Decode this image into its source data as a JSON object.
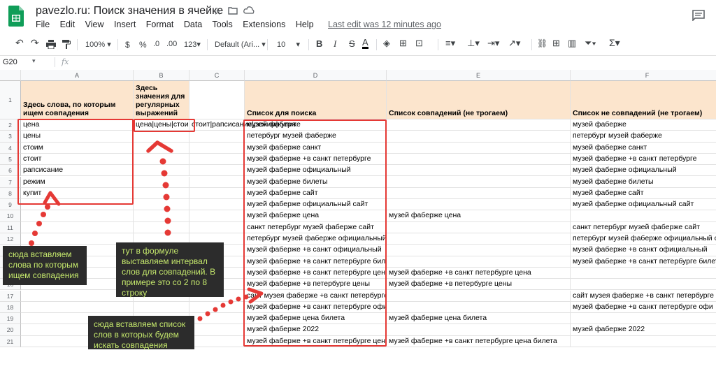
{
  "app": {
    "doc_title": "pavezlo.ru: Поиск значения в ячейке",
    "menu": [
      "File",
      "Edit",
      "View",
      "Insert",
      "Format",
      "Data",
      "Tools",
      "Extensions",
      "Help"
    ],
    "last_edit": "Last edit was 12 minutes ago",
    "logo_color": "#0f9d58"
  },
  "toolbar": {
    "zoom": "100%",
    "currency": "$",
    "percent": "%",
    "decimal_less": ".0",
    "decimal_more": ".00",
    "format_more": "123",
    "font": "Default (Ari...",
    "font_size": "10",
    "bold": "B",
    "italic": "I",
    "strike": "S",
    "text_color": "A"
  },
  "formula_bar": {
    "name_box": "G20",
    "fx": "fx"
  },
  "columns": [
    "A",
    "B",
    "C",
    "D",
    "E",
    "F"
  ],
  "rows": [
    "1",
    "2",
    "3",
    "4",
    "5",
    "6",
    "7",
    "8",
    "9",
    "10",
    "11",
    "12",
    "13",
    "14",
    "15",
    "16",
    "17",
    "18",
    "19",
    "20",
    "21"
  ],
  "headers": {
    "A": "Здесь слова, по которым ищем совпадения",
    "B": "Здесь значения для регулярных выражений",
    "D": "Список для поиска",
    "E": "Список совпадений (не трогаем)",
    "F": "Список не совпадений (не трогаем)"
  },
  "col_a": [
    "цена",
    "цены",
    "стоим",
    "стоит",
    "рапсисание",
    "режим",
    "купит",
    "",
    "",
    "",
    "",
    "",
    "",
    "",
    "",
    "",
    "",
    "",
    "",
    ""
  ],
  "col_b": [
    "цена|цены|стоим",
    "",
    "",
    "",
    "",
    "",
    "",
    "",
    "",
    "",
    "",
    "",
    "",
    "",
    "",
    "",
    "",
    "",
    "",
    ""
  ],
  "col_c": [
    "стоит|рапсисание|режим|купит",
    "",
    "",
    "",
    "",
    "",
    "",
    "",
    "",
    "",
    "",
    "",
    "",
    "",
    "",
    "",
    "",
    "",
    "",
    ""
  ],
  "col_d": [
    "музей фаберже",
    "петербург музей фаберже",
    "музей фаберже санкт",
    "музей фаберже +в санкт петербурге",
    "музей фаберже официальный",
    "музей фаберже билеты",
    "музей фаберже сайт",
    "музей фаберже официальный сайт",
    "музей фаберже цена",
    "санкт петербург музей фаберже сайт",
    "петербург музей фаберже официальный",
    "музей фаберже +в санкт официальный",
    "музей фаберже +в санкт петербурге билеты",
    "музей фаберже +в санкт петербурге цена",
    "музей фаберже +в петербурге цены",
    "сайт музея фаберже +в санкт петербурге",
    "музей фаберже +в санкт петербурге официальный",
    "музей фаберже цена билета",
    "музей фаберже 2022",
    "музей фаберже +в санкт петербурге цена билета"
  ],
  "col_e": [
    "",
    "",
    "",
    "",
    "",
    "",
    "",
    "",
    "музей фаберже цена",
    "",
    "",
    "",
    "",
    "музей фаберже +в санкт петербурге цена",
    "музей фаберже +в петербурге цены",
    "",
    "",
    "музей фаберже цена билета",
    "",
    "музей фаберже +в санкт петербурге цена билета"
  ],
  "col_f": [
    "музей фаберже",
    "петербург музей фаберже",
    "музей фаберже санкт",
    "музей фаберже +в санкт петербурге",
    "музей фаберже официальный",
    "музей фаберже билеты",
    "музей фаберже сайт",
    "музей фаберже официальный сайт",
    "",
    "санкт петербург музей фаберже сайт",
    "петербург музей фаберже официальный сайт",
    "музей фаберже +в санкт официальный",
    "музей фаберже +в санкт петербурге билеты",
    "",
    "",
    "сайт музея фаберже +в санкт петербурге",
    "музей фаберже +в санкт петербурге офи",
    "",
    "музей фаберже 2022",
    ""
  ],
  "notes": {
    "words": "сюда вставляем слова по которым ищем совпадения",
    "formula": "тут в формуле выставляем интервал слов для совпадений. В примере это со 2 по 8 строку",
    "list": "сюда вставляем список слов в которых будем искать совпадения"
  },
  "colors": {
    "header_fill": "#fce5cd",
    "annotation_red": "#e53935",
    "note_bg": "#2c2c2c",
    "note_text": "#c5e86c"
  }
}
